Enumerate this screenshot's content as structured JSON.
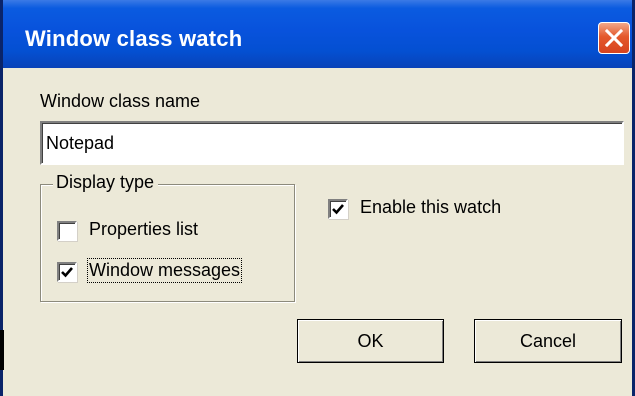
{
  "window": {
    "title": "Window class watch",
    "close_icon": "close-icon",
    "accent_color": "#0852dc",
    "close_color": "#d7431f"
  },
  "class_name": {
    "label": "Window class name",
    "value": "Notepad"
  },
  "display_type": {
    "legend": "Display type",
    "options": [
      {
        "label": "Properties list",
        "checked": false
      },
      {
        "label": "Window messages",
        "checked": true
      }
    ]
  },
  "enable_watch": {
    "label": "Enable this watch",
    "checked": true
  },
  "buttons": {
    "ok": "OK",
    "cancel": "Cancel"
  }
}
